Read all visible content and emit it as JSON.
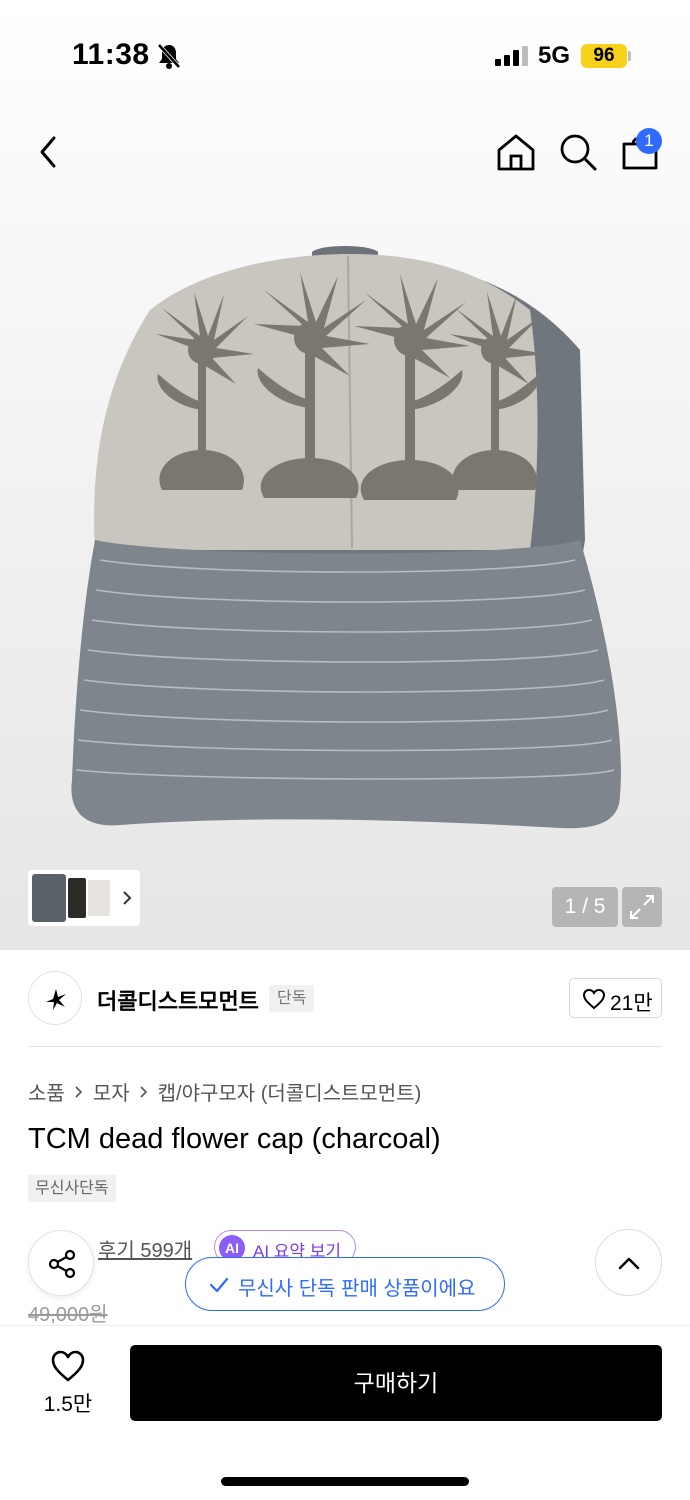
{
  "status_bar": {
    "time": "11:38",
    "network": "5G",
    "battery": "96"
  },
  "nav": {
    "cart_badge": "1"
  },
  "gallery": {
    "page_counter": "1 / 5"
  },
  "brand": {
    "name": "더콜디스트모먼트",
    "tag": "단독",
    "like_count": "21만"
  },
  "breadcrumb": [
    "소품",
    "모자",
    "캡/야구모자 (더콜디스트모먼트)"
  ],
  "product": {
    "title": "TCM dead flower cap (charcoal)",
    "exclusive_tag": "무신사단독",
    "reviews": "후기 599개",
    "ai_badge": "AI",
    "ai_summary": "AI 요약 보기",
    "old_price": "49,000원"
  },
  "toast": {
    "text": "무신사 단독 판매 상품이에요"
  },
  "bottom_bar": {
    "wish_count": "1.5만",
    "buy_label": "구매하기"
  },
  "colors": {
    "accent_blue": "#2f6bff",
    "ai_purple": "#8b5cf6",
    "battery_yellow": "#f6d21a"
  }
}
